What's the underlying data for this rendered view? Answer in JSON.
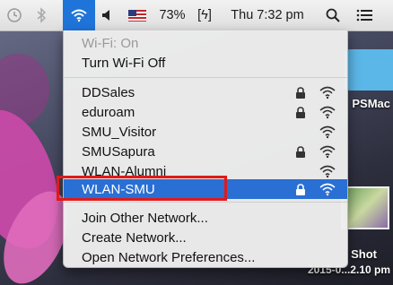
{
  "menubar": {
    "battery_percent": "73%",
    "battery_glyph": "[ϟ]",
    "clock": "Thu 7:32 pm"
  },
  "menu": {
    "status_wifi": "Wi-Fi: On",
    "turn_off": "Turn Wi-Fi Off",
    "networks": [
      {
        "name": "DDSales",
        "locked": true
      },
      {
        "name": "eduroam",
        "locked": true
      },
      {
        "name": "SMU_Visitor",
        "locked": false
      },
      {
        "name": "SMUSapura",
        "locked": true
      },
      {
        "name": "WLAN-Alumni",
        "locked": false
      },
      {
        "name": "WLAN-SMU",
        "locked": true,
        "selected": true
      }
    ],
    "join_other": "Join Other Network...",
    "create_network": "Create Network...",
    "open_prefs": "Open Network Preferences..."
  },
  "desktop": {
    "label_psmac": "PSMac",
    "label_shot": "Shot",
    "label_date": "2015-0...2.10 pm"
  },
  "colors": {
    "selection": "#2a6fd3",
    "highlight": "#e0191a"
  }
}
